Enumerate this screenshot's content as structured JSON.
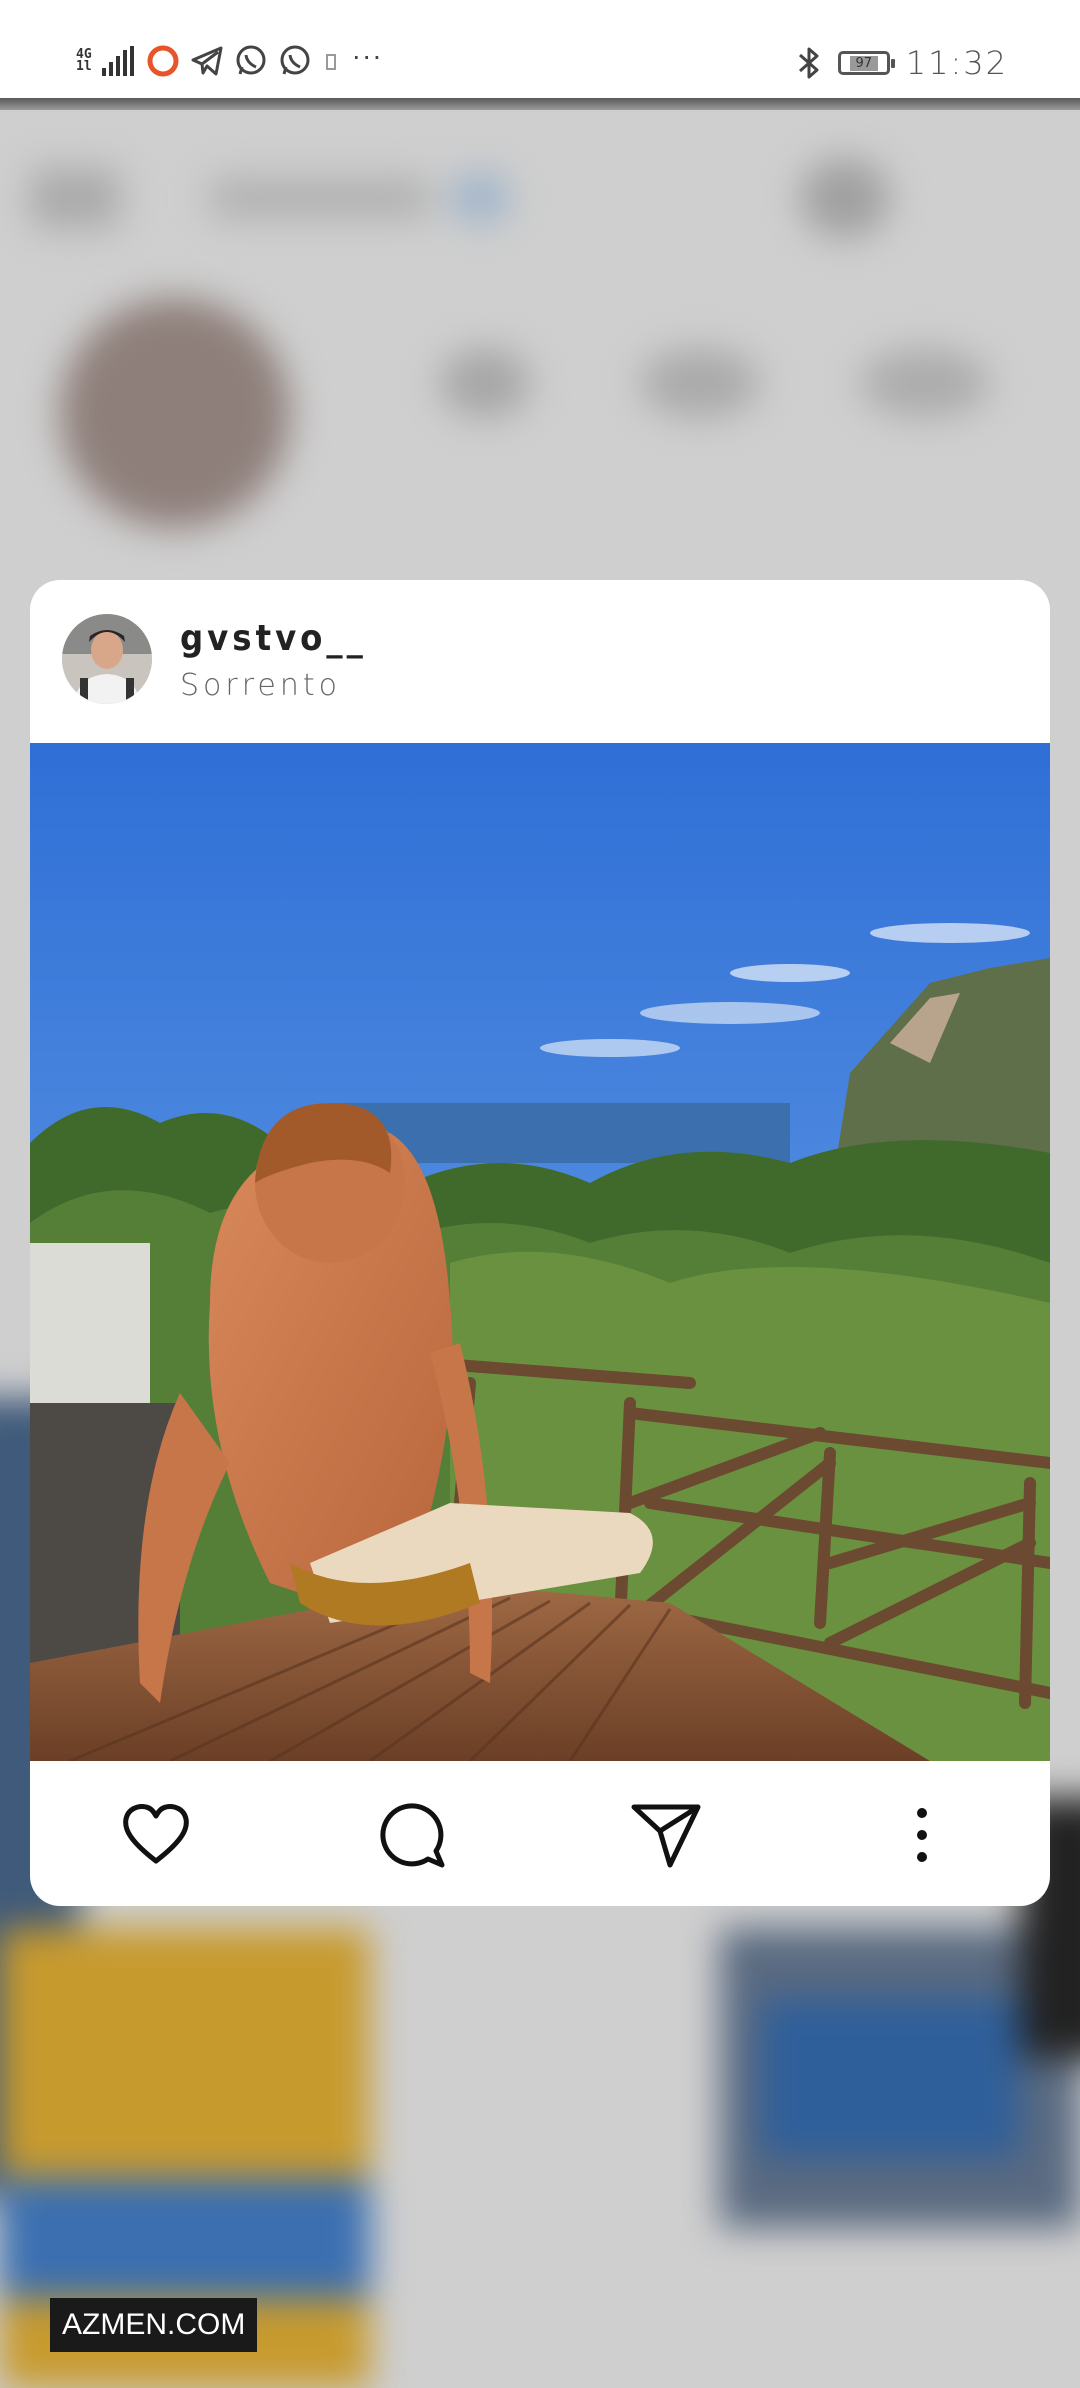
{
  "status_bar": {
    "network_type_top": "4G",
    "network_type_bottom": "1l",
    "battery_level": "97",
    "time": "11:32",
    "notification_icons": [
      "record-icon",
      "telegram-icon",
      "whatsapp-icon",
      "whatsapp-icon",
      "small-app-icon",
      "more-icon"
    ],
    "right_icons": [
      "bluetooth-icon",
      "battery-icon"
    ]
  },
  "post": {
    "username": "gvstvo__",
    "location": "Sorrento",
    "actions": [
      "heart-icon",
      "comment-icon",
      "share-icon",
      "more-options-icon"
    ]
  },
  "watermark": "AZMEN.COM"
}
